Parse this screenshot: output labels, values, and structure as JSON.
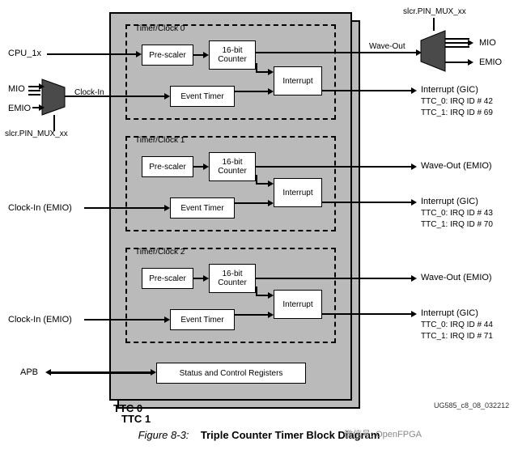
{
  "inputs": {
    "cpu": "CPU_1x",
    "mio": "MIO",
    "emio": "EMIO",
    "slcr": "slcr.PIN_MUX_xx",
    "clock_in": "Clock-In",
    "clock_in_emio1": "Clock-In (EMIO)",
    "clock_in_emio2": "Clock-In (EMIO)",
    "apb": "APB"
  },
  "top_mux": {
    "slcr": "slcr.PIN_MUX_xx",
    "wave_out": "Wave-Out",
    "mio": "MIO",
    "emio": "EMIO"
  },
  "groups": [
    {
      "title": "Timer/Clock 0",
      "prescaler": "Pre-scaler",
      "counter": "16-bit\nCounter",
      "event_timer": "Event Timer",
      "interrupt": "Interrupt"
    },
    {
      "title": "Timer/Clock 1",
      "prescaler": "Pre-scaler",
      "counter": "16-bit\nCounter",
      "event_timer": "Event Timer",
      "interrupt": "Interrupt"
    },
    {
      "title": "Timer/Clock 2",
      "prescaler": "Pre-scaler",
      "counter": "16-bit\nCounter",
      "event_timer": "Event Timer",
      "interrupt": "Interrupt"
    }
  ],
  "status_reg": "Status and Control Registers",
  "ttc": {
    "front": "TTC 0",
    "back": "TTC 1"
  },
  "outputs": {
    "int0": "Interrupt (GIC)",
    "int0_a": "TTC_0: IRQ ID # 42",
    "int0_b": "TTC_1: IRQ ID # 69",
    "wave1": "Wave-Out (EMIO)",
    "int1": "Interrupt (GIC)",
    "int1_a": "TTC_0: IRQ ID # 43",
    "int1_b": "TTC_1: IRQ ID # 70",
    "wave2": "Wave-Out (EMIO)",
    "int2": "Interrupt (GIC)",
    "int2_a": "TTC_0: IRQ ID # 44",
    "int2_b": "TTC_1: IRQ ID # 71"
  },
  "docid": "UG585_c8_08_032212",
  "caption_prefix": "Figure 8-3:",
  "caption_title": "Triple Counter Timer Block Diagram",
  "watermark": "微信号: OpenFPGA"
}
